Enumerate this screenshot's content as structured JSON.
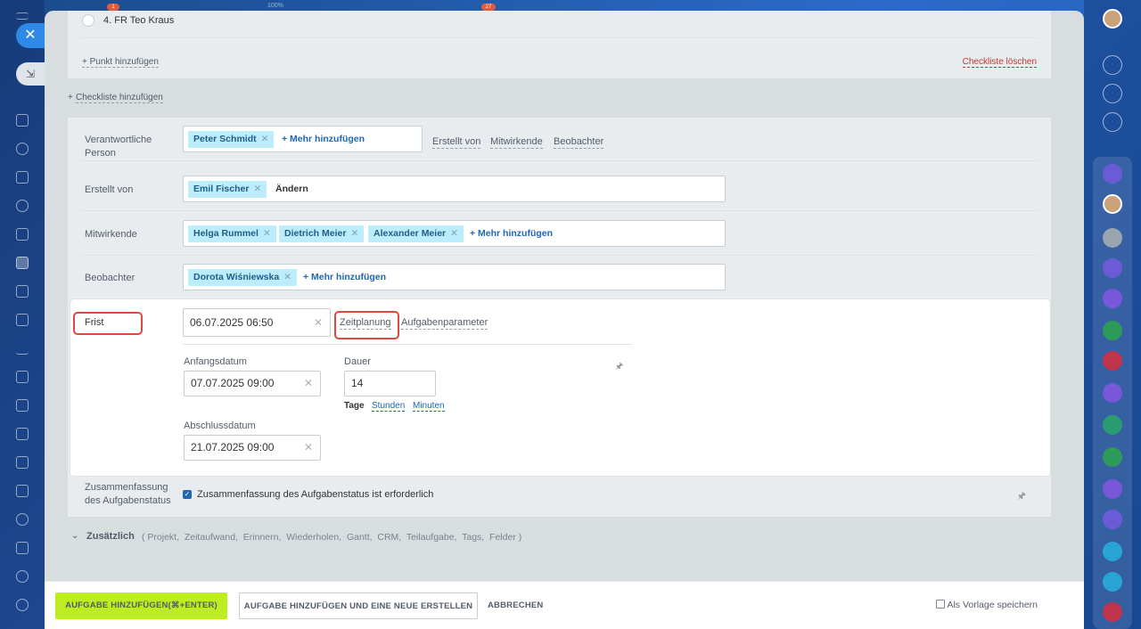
{
  "top_hint": {
    "zoom": "100%",
    "badge_left": "1",
    "badge_right": "27"
  },
  "checklist": {
    "item": "4. FR Teo Kraus",
    "add_item": "+ Punkt hinzufügen",
    "delete": "Checkliste löschen",
    "add_checklist_prefix": "+",
    "add_checklist": "Checkliste hinzufügen"
  },
  "responsible": {
    "label": "Verantwortliche Person",
    "people": [
      "Peter Schmidt"
    ],
    "add_more": "+ Mehr hinzufügen",
    "tabs": [
      "Erstellt von",
      "Mitwirkende",
      "Beobachter"
    ]
  },
  "creator": {
    "label": "Erstellt von",
    "people": [
      "Emil Fischer"
    ],
    "change": "Ändern"
  },
  "participants": {
    "label": "Mitwirkende",
    "people": [
      "Helga Rummel",
      "Dietrich Meier",
      "Alexander Meier"
    ],
    "add_more": "+ Mehr hinzufügen"
  },
  "observers": {
    "label": "Beobachter",
    "people": [
      "Dorota Wiśniewska"
    ],
    "add_more": "+ Mehr hinzufügen"
  },
  "deadline": {
    "label": "Frist",
    "value": "06.07.2025 06:50",
    "tab_planning": "Zeitplanung",
    "tab_params": "Aufgabenparameter",
    "start_label": "Anfangsdatum",
    "start_value": "07.07.2025 09:00",
    "duration_label": "Dauer",
    "duration_value": "14",
    "units": [
      "Tage",
      "Stunden",
      "Minuten"
    ],
    "end_label": "Abschlussdatum",
    "end_value": "21.07.2025 09:00",
    "highlight_color": "#e0473d"
  },
  "summary": {
    "label": "Zusammenfassung des Aufgabenstatus",
    "checkbox_text": "Zusammenfassung des Aufgabenstatus ist erforderlich",
    "checked": true
  },
  "additional": {
    "title": "Zusätzlich",
    "items_text": "( Projekt,  Zeitaufwand,  Erinnern,  Wiederholen,  Gantt,  CRM,  Teilaufgabe,  Tags,  Felder )"
  },
  "footer": {
    "primary": "AUFGABE HINZUFÜGEN(⌘+ENTER)",
    "secondary": "AUFGABE HINZUFÜGEN UND EINE NEUE ERSTELLEN",
    "cancel": "ABBRECHEN",
    "save_template": "Als Vorlage speichern",
    "primary_color": "#bbed21"
  },
  "icons": {
    "close": "close-icon",
    "pin": "pin-icon",
    "chevron": "chevron-down-icon"
  }
}
